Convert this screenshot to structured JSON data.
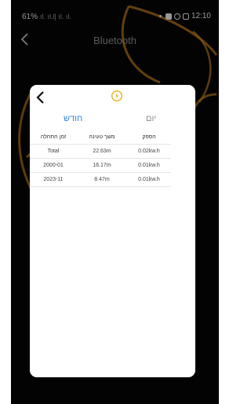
{
  "status_bar": {
    "battery": "61%",
    "signal_text": "ıl. ıl.l| ıl. ıl.",
    "time": "12:10"
  },
  "top_bar": {
    "title": "Bluetooth"
  },
  "dialog": {
    "tabs": {
      "month": "חודש",
      "day": "יום"
    },
    "table": {
      "headers": [
        "זמן התחלה",
        "משך טעינה",
        "הספק"
      ],
      "rows": [
        [
          "Total",
          "22.63m",
          "0.02kw.h"
        ],
        [
          "2000-01",
          "16.17m",
          "0.01kw.h"
        ],
        [
          "2023-11",
          "8.47m",
          "0.01kw.h"
        ]
      ]
    },
    "icon": "clock-lightning-icon"
  },
  "colors": {
    "accent_blue": "#2f86e8",
    "icon_gold": "#e8b21a",
    "background_art": "#c9821c"
  }
}
